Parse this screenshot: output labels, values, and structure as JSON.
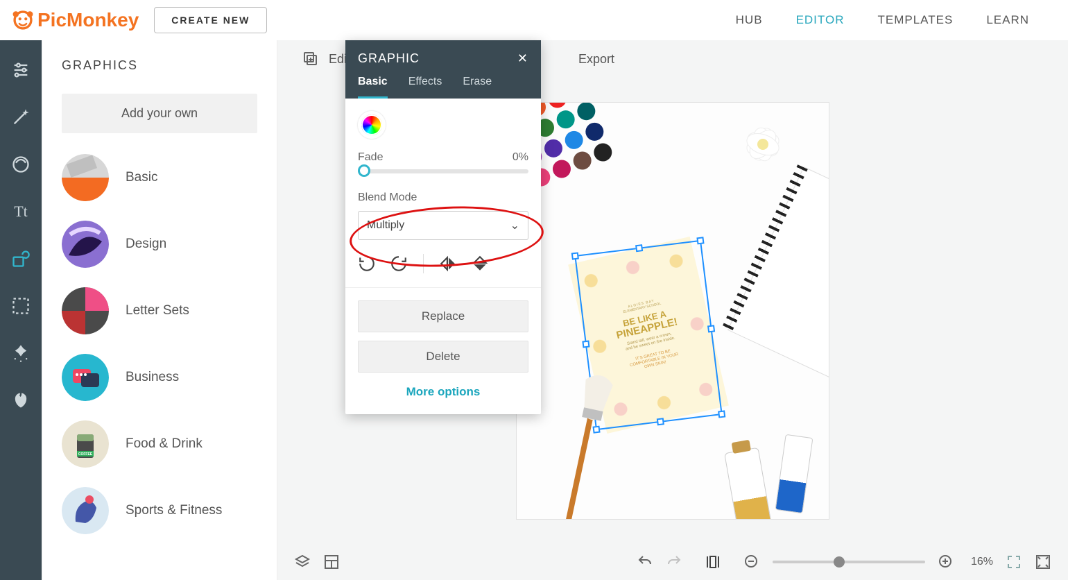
{
  "header": {
    "brand": "PicMonkey",
    "create_new": "CREATE NEW",
    "nav": {
      "hub": "HUB",
      "editor": "EDITOR",
      "templates": "TEMPLATES",
      "learn": "LEARN"
    }
  },
  "rail_tools": [
    "adjustments",
    "magic",
    "touchup",
    "text",
    "graphics",
    "frames",
    "textures",
    "themes"
  ],
  "sidebar": {
    "title": "GRAPHICS",
    "add_own": "Add your own",
    "categories": [
      {
        "label": "Basic"
      },
      {
        "label": "Design"
      },
      {
        "label": "Letter Sets"
      },
      {
        "label": "Business"
      },
      {
        "label": "Food & Drink"
      },
      {
        "label": "Sports & Fitness"
      }
    ]
  },
  "workspace_toolbar": {
    "edits": "Edits",
    "export": "Export"
  },
  "panel": {
    "title": "GRAPHIC",
    "tabs": {
      "basic": "Basic",
      "effects": "Effects",
      "erase": "Erase"
    },
    "fade_label": "Fade",
    "fade_value": "0%",
    "blend_label": "Blend Mode",
    "blend_value": "Multiply",
    "replace": "Replace",
    "delete": "Delete",
    "more": "More options"
  },
  "poster": {
    "pre": "ALGIES BAY",
    "sub": "ELEMENTARY SCHOOL",
    "line1": "BE LIKE A",
    "line2": "PINEAPPLE!",
    "small1": "Stand tall, wear a crown,",
    "small2": "and be sweet on the inside.",
    "small3": "IT'S GREAT TO BE",
    "small4": "COMFORTABLE IN YOUR",
    "small5": "OWN SKIN!"
  },
  "bottom": {
    "zoom": "16%"
  }
}
